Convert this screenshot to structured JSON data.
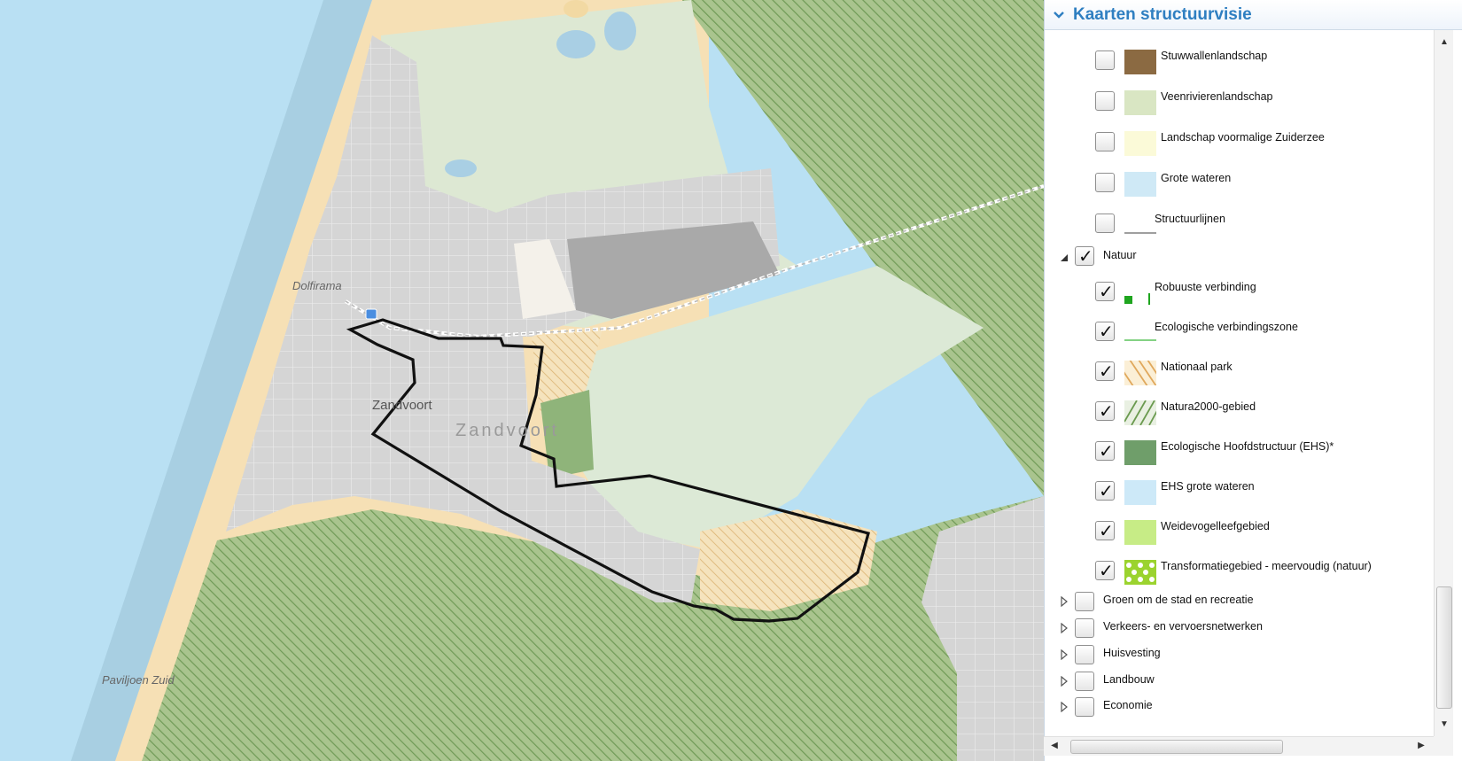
{
  "map": {
    "labels": {
      "dolfirama": "Dolfirama",
      "town": "Zandvoort",
      "town_area": "Zandvoort",
      "paviljoen": "Paviljoen Zuid"
    },
    "colors": {
      "sea": "#b9e0f3",
      "beach": "#f6e0b5",
      "urban": "#d7d7d7",
      "nature_green": "#8fb47a",
      "light_green": "#dde9d6",
      "boundary": "#111111"
    }
  },
  "panel": {
    "title": "Kaarten structuurvisie",
    "items": [
      {
        "label": "Stuwwallenlandschap",
        "checked": false,
        "swatch": "brown-fill",
        "color": "#8b6a42"
      },
      {
        "label": "Veenrivierenlandschap",
        "checked": false,
        "swatch": "light-green-fill",
        "color": "#d9e6c3"
      },
      {
        "label": "Landschap voormalige Zuiderzee",
        "checked": false,
        "swatch": "cream-fill",
        "color": "#fbfad8"
      },
      {
        "label": "Grote wateren",
        "checked": false,
        "swatch": "light-blue-fill",
        "color": "#cfe9f6"
      },
      {
        "label": "Structuurlijnen",
        "checked": false,
        "swatch": "grey-line",
        "color": "#666666"
      }
    ],
    "natuur_group": {
      "label": "Natuur",
      "checked": true,
      "expanded": true
    },
    "natuur_items": [
      {
        "label": "Robuuste verbinding",
        "checked": true,
        "swatch": "green-square-line",
        "color": "#1fa51f"
      },
      {
        "label": "Ecologische verbindingszone",
        "checked": true,
        "swatch": "green-line",
        "color": "#5bc35b"
      },
      {
        "label": "Nationaal park",
        "checked": true,
        "swatch": "orange-hatch",
        "color": "#e0a85c"
      },
      {
        "label": "Natura2000-gebied",
        "checked": true,
        "swatch": "green-hatch",
        "color": "#6a9a4f"
      },
      {
        "label": "Ecologische Hoofdstructuur (EHS)*",
        "checked": true,
        "swatch": "dark-green-fill",
        "color": "#6f9e6a"
      },
      {
        "label": "EHS grote wateren",
        "checked": true,
        "swatch": "light-blue-fill",
        "color": "#cde9f8"
      },
      {
        "label": "Weidevogelleefgebied",
        "checked": true,
        "swatch": "lime-fill",
        "color": "#c7ec86"
      },
      {
        "label": "Transformatiegebied - meervoudig (natuur)",
        "checked": true,
        "swatch": "lattice",
        "color": "#9bd32f"
      }
    ],
    "groups": [
      {
        "label": "Groen om de stad en recreatie",
        "checked": false
      },
      {
        "label": "Verkeers- en vervoersnetwerken",
        "checked": false
      },
      {
        "label": "Huisvesting",
        "checked": false
      },
      {
        "label": "Landbouw",
        "checked": false
      },
      {
        "label": "Economie",
        "checked": false
      }
    ]
  }
}
